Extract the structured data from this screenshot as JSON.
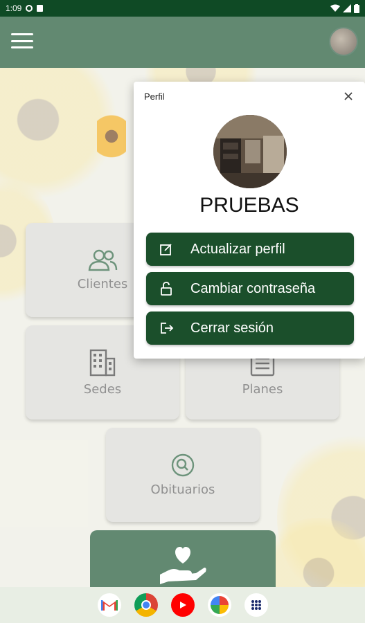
{
  "status_bar": {
    "time": "1:09"
  },
  "dashboard": {
    "tiles": [
      {
        "label": "Clientes"
      },
      {
        "label": "Sedes"
      },
      {
        "label": "Planes"
      },
      {
        "label": "Obituarios"
      }
    ]
  },
  "profile_dialog": {
    "title": "Perfil",
    "user_name": "PRUEBAS",
    "buttons": [
      {
        "label": "Actualizar perfil",
        "icon": "edit-icon"
      },
      {
        "label": "Cambiar contraseña",
        "icon": "unlock-icon"
      },
      {
        "label": "Cerrar sesión",
        "icon": "logout-icon"
      }
    ]
  },
  "dock": [
    "gmail-icon",
    "chrome-icon",
    "youtube-icon",
    "photos-icon",
    "app-drawer-icon"
  ],
  "colors": {
    "primary": "#0f4a25",
    "button": "#1b4f2b",
    "tile": "#d8d8d3"
  }
}
